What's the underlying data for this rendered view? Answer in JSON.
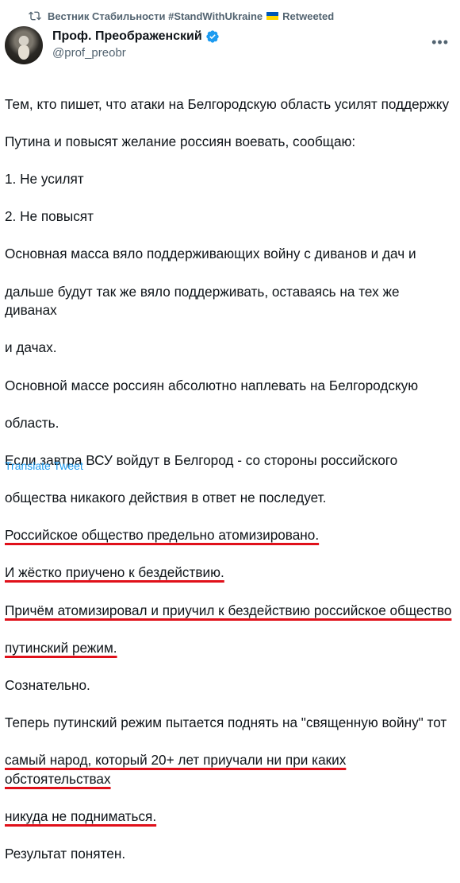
{
  "retweet": {
    "account": "Вестник Стабильности #StandWithUkraine",
    "label": "Retweeted",
    "icon": "retweet-icon"
  },
  "author": {
    "display_name": "Проф. Преображенский",
    "handle": "@prof_preobr",
    "verified_color": "#1d9bf0"
  },
  "tweet": {
    "lines": [
      "Тем, кто пишет, что атаки на Белгородскую область усилят поддержку",
      "Путина и повысят желание россиян воевать, сообщаю:",
      "1. Не усилят",
      "2. Не повысят",
      "Основная масса вяло поддерживающих войну с диванов и дач и",
      "дальше будут так же вяло поддерживать, оставаясь на тех же диванах",
      "и дачах.",
      "Основной массе россиян абсолютно наплевать на Белгородскую",
      "область.",
      "Если завтра ВСУ войдут в Белгород - со стороны российского",
      "общества никакого действия в ответ не последует.",
      "Российское общество предельно атомизировано.",
      "И жёстко приучено к бездействию.",
      "Причём атомизировал и приучил к бездействию российское общество",
      "путинский режим.",
      "Сознательно.",
      "Теперь путинский режим пытается поднять на \"священную войну\" тот",
      "самый народ, который 20+ лет приучали ни при каких обстоятельствах",
      "никуда не подниматься.",
      "Результат понятен."
    ]
  },
  "translate_label": "Translate Tweet",
  "colors": {
    "text": "#0f1419",
    "muted": "#536471",
    "link": "#1d9bf0",
    "annotation": "#e0101a"
  }
}
